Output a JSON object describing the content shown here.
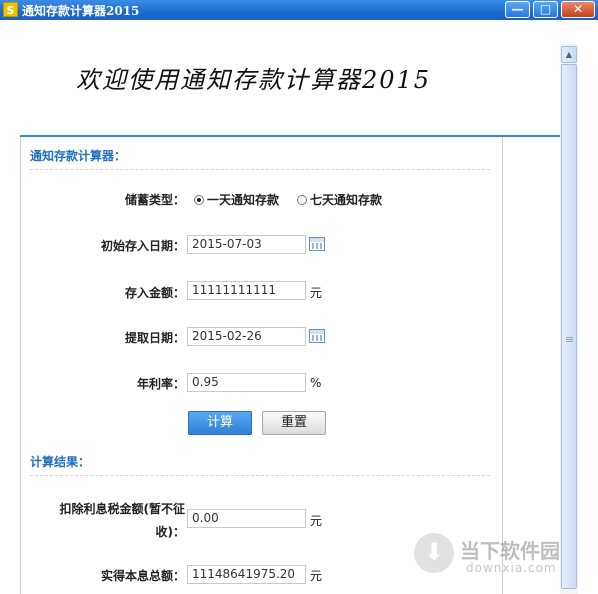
{
  "window": {
    "title": "通知存款计算器2015",
    "app_icon_letter": "S",
    "controls": {
      "minimize": "—",
      "maximize": "□",
      "close": "✕"
    }
  },
  "banner": {
    "welcome": "欢迎使用通知存款计算器2015"
  },
  "calculator": {
    "section_title": "通知存款计算器：",
    "savings_type": {
      "label": "储蓄类型：",
      "options": [
        {
          "label": "一天通知存款",
          "selected": true
        },
        {
          "label": "七天通知存款",
          "selected": false
        }
      ]
    },
    "start_date": {
      "label": "初始存入日期：",
      "value": "2015-07-03",
      "icon": "calendar-icon"
    },
    "amount": {
      "label": "存入金额：",
      "value": "11111111111",
      "unit": "元"
    },
    "withdraw_date": {
      "label": "提取日期：",
      "value": "2015-02-26",
      "icon": "calendar-icon"
    },
    "rate": {
      "label": "年利率：",
      "value": "0.95",
      "unit": "%"
    },
    "buttons": {
      "calculate": "计算",
      "reset": "重置"
    }
  },
  "results": {
    "section_title": "计算结果：",
    "interest_after_tax": {
      "label_line1": "扣除利息税金额(暂不征",
      "label_line2": "收)：",
      "value": "0.00",
      "unit": "元"
    },
    "total": {
      "label": "实得本息总额：",
      "value": "11148641975.20",
      "unit": "元"
    }
  },
  "watermark": {
    "name": "当下软件园",
    "url": "downxia.com"
  },
  "colors": {
    "accent": "#1f6fc0",
    "titlebar": "#1c6bcf",
    "primary_button": "#2f80d6"
  }
}
